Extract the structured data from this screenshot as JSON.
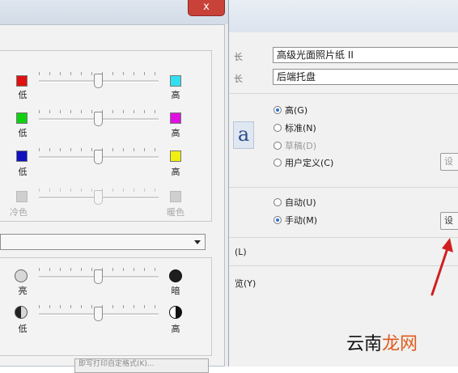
{
  "left_dialog": {
    "close_label": "x",
    "color_rows": [
      {
        "low_label": "低",
        "high_label": "高",
        "low_color": "#e01010",
        "high_color": "#30e0f0",
        "disabled": false
      },
      {
        "low_label": "低",
        "high_label": "高",
        "low_color": "#10d010",
        "high_color": "#e010e0",
        "disabled": false
      },
      {
        "low_label": "低",
        "high_label": "高",
        "low_color": "#1010c0",
        "high_color": "#f0f010",
        "disabled": false
      },
      {
        "low_label": "冷色",
        "high_label": "暖色",
        "low_color": "#cfcfcf",
        "high_color": "#cfcfcf",
        "disabled": true
      }
    ],
    "adjust_rows": [
      {
        "low_label": "亮",
        "high_label": "暗",
        "low_icon": "light-circle-icon",
        "high_icon": "dark-circle-icon"
      },
      {
        "low_label": "低",
        "high_label": "高",
        "low_icon": "half-dark-left-circle-icon",
        "high_icon": "half-dark-right-circle-icon"
      }
    ],
    "bottom_button_label": "即写打印自定格式(K)..."
  },
  "right_window": {
    "paper_type": "高级光面照片纸 II",
    "paper_source": "后端托盘",
    "paper_type_edge": "长",
    "paper_source_edge": "长",
    "print_quality": [
      {
        "label": "高(G)",
        "checked": true,
        "disabled": false
      },
      {
        "label": "标准(N)",
        "checked": false,
        "disabled": false
      },
      {
        "label": "草稿(D)",
        "checked": false,
        "disabled": true
      },
      {
        "label": "用户定义(C)",
        "checked": false,
        "disabled": false
      }
    ],
    "color_intensity": [
      {
        "label": "自动(U)",
        "checked": false
      },
      {
        "label": "手动(M)",
        "checked": true
      }
    ],
    "quality_set_button": "设",
    "manual_set_button": "设",
    "letter_a": "a",
    "option_L": "(L)",
    "option_Y": "览(Y)"
  },
  "watermark": {
    "part1": "云南",
    "part2": "龙网"
  },
  "colors": {
    "accent_radio": "#2a6fd6",
    "close_red": "#c8423a",
    "arrow_red": "#d02020"
  }
}
